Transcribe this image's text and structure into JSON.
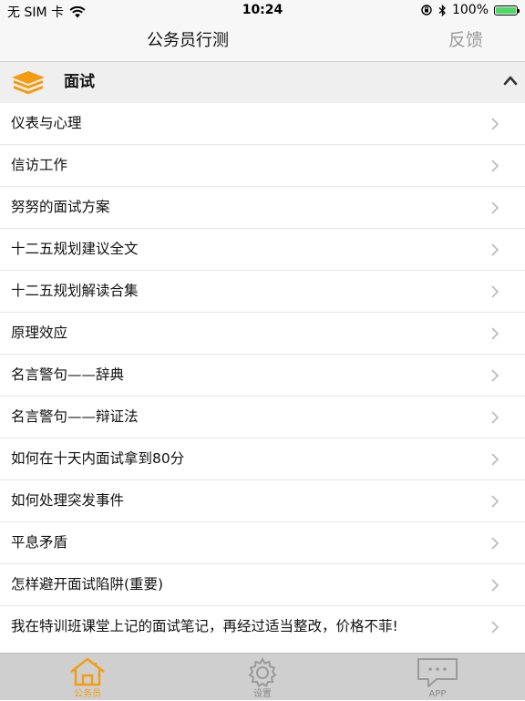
{
  "status_bar": {
    "carrier": "无 SIM 卡",
    "time": "10:24",
    "battery": "100%",
    "battery_level": 1.0,
    "icons": [
      "wifi-icon",
      "orientation-lock-icon",
      "bluetooth-icon",
      "battery-icon"
    ]
  },
  "nav": {
    "title": "公务员行测",
    "right_button": "反馈"
  },
  "section": {
    "title": "面试",
    "icon": "layers-icon",
    "accent": "#f39c12",
    "collapse_icon": "chevron-up-icon"
  },
  "list": {
    "items": [
      "仪表与心理",
      "信访工作",
      "努努的面试方案",
      "十二五规划建议全文",
      "十二五规划解读合集",
      "原理效应",
      "名言警句——辞典",
      "名言警句——辩证法",
      "如何在十天内面试拿到80分",
      "如何处理突发事件",
      "平息矛盾",
      "怎样避开面试陷阱(重要)",
      "我在特训班课堂上记的面试笔记，再经过适当整改，价格不菲!"
    ]
  },
  "tabs": [
    {
      "label": "公务员",
      "icon": "home-icon",
      "active": true
    },
    {
      "label": "设置",
      "icon": "gear-icon",
      "active": false
    },
    {
      "label": "APP",
      "icon": "chat-bubble-icon",
      "active": false
    }
  ],
  "colors": {
    "active_tab": "#f39c12",
    "inactive_tab": "#8a8a8a",
    "battery": "#4cd964"
  }
}
